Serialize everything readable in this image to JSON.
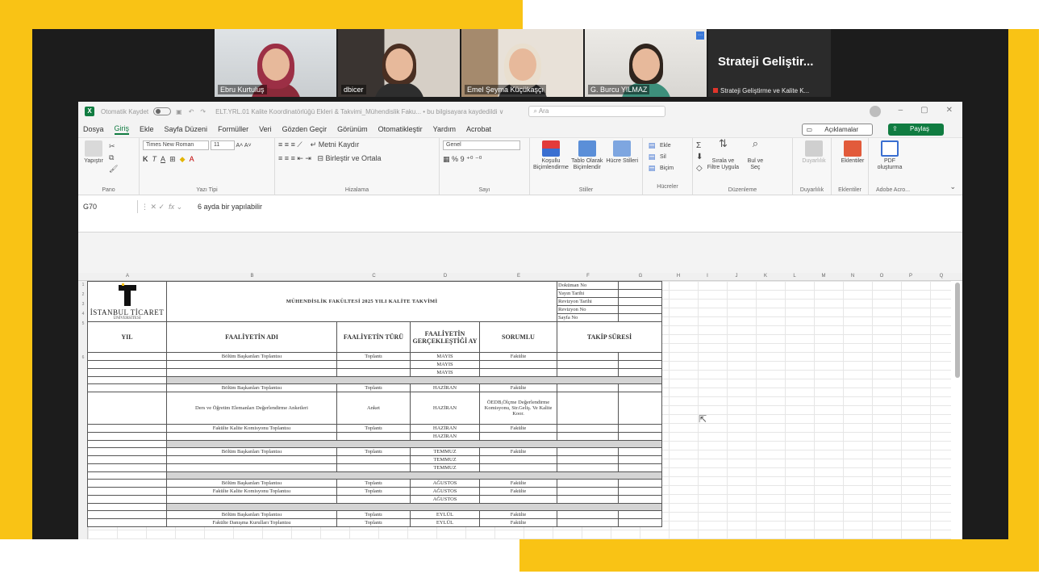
{
  "participants": [
    {
      "name": "Ebru Kurtuluş",
      "active": true
    },
    {
      "name": "dbicer",
      "active": false
    },
    {
      "name": "Emel Şeyma Küçükaşçı",
      "active": false
    },
    {
      "name": "G. Burcu YILMAZ",
      "active": false
    }
  ],
  "share": {
    "title": "Strateji Geliştir...",
    "subtitle": "Strateji Geliştirme ve Kalite K..."
  },
  "excel": {
    "autosave": "Otomatik Kaydet",
    "filename": "ELT.YRL.01 Kalite Koordinatörlüğü Ekleri & Takvimi_Mühendislik Faku... • bu bilgisayara kaydedildi ∨",
    "search": "Ara",
    "menu": [
      "Dosya",
      "Giriş",
      "Ekle",
      "Sayfa Düzeni",
      "Formüller",
      "Veri",
      "Gözden Geçir",
      "Görünüm",
      "Otomatikleştir",
      "Yardım",
      "Acrobat"
    ],
    "comments": "Açıklamalar",
    "share": "Paylaş",
    "ribbon": {
      "paste": "Yapıştır",
      "clipboard": "Pano",
      "font": "Times New Roman",
      "fontsize": "11",
      "font_group": "Yazı Tipi",
      "wrap": "Metni Kaydır",
      "merge": "Birleştir ve Ortala",
      "align_group": "Hizalama",
      "numfmt": "Genel",
      "number_group": "Sayı",
      "cond": "Koşullu Biçimlendirme",
      "astable": "Tablo Olarak Biçimlendir",
      "cellstyles": "Hücre Stilleri",
      "styles_group": "Stiller",
      "insert": "Ekle",
      "delete": "Sil",
      "format": "Biçim",
      "cells_group": "Hücreler",
      "sortfilter": "Sırala ve Filtre Uygula",
      "findselect": "Bul ve Seç",
      "edit_group": "Düzenleme",
      "sensitivity": "Duyarlılık",
      "sens_group": "Duyarlılık",
      "addins": "Eklentiler",
      "addins_group": "Eklentiler",
      "pdf": "PDF oluşturma",
      "acrobat_group": "Adobe Acro..."
    },
    "namebox": "G70",
    "formula": "6 ayda bir yapılabilir",
    "columns": [
      "A",
      "B",
      "C",
      "D",
      "E",
      "F",
      "G",
      "H",
      "I",
      "J",
      "K",
      "L",
      "M",
      "N",
      "O",
      "P",
      "Q"
    ]
  },
  "sheet": {
    "logo_line1": "İSTANBUL TİCARET",
    "logo_line2": "ÜNİVERSİTESİ",
    "title": "MÜHENDİSLİK FAKÜLTESİ 2025 YILI KALİTE TAKVİMİ",
    "docinfo": [
      "Doküman No",
      "Yayın Tarihi",
      "Revizyon Tarihi",
      "Revizyon No",
      "Sayfa No"
    ],
    "headers": [
      "YIL",
      "FAALİYETİN ADI",
      "FAALİYETİN TÜRÜ",
      "FAALİYETİN GERÇEKLEŞTİĞİ AY",
      "SORUMLU",
      "TAKİP SÜRESİ"
    ],
    "rows": [
      {
        "n": "7",
        "name": "Bölüm Başkanları Toplantısı",
        "type": "Toplantı",
        "month": "MAYIS",
        "resp": "Fakülte"
      },
      {
        "n": "8",
        "name": "",
        "type": "",
        "month": "MAYIS",
        "resp": ""
      },
      {
        "n": "9",
        "name": "",
        "type": "",
        "month": "MAYIS",
        "resp": ""
      },
      {
        "n": "10",
        "gray": true
      },
      {
        "n": "11",
        "name": "Bölüm Başkanları Toplantısı",
        "type": "Toplantı",
        "month": "HAZİRAN",
        "resp": "Fakülte"
      },
      {
        "n": "12",
        "tall": true,
        "name": "Ders ve Öğretim Elemanları Değerlendirme Anketleri",
        "type": "Anket",
        "month": "HAZİRAN",
        "resp": "ÖEDB,Ölçme Değerlendirme Komisyonu, Str.Geliş. Ve Kalite Koor."
      },
      {
        "n": "13",
        "name": "Fakülte Kalite Komisyonu Toplantısı",
        "type": "Toplantı",
        "month": "HAZİRAN",
        "resp": "Fakülte"
      },
      {
        "n": "14",
        "name": "",
        "type": "",
        "month": "HAZİRAN",
        "resp": ""
      },
      {
        "n": "15",
        "gray": true
      },
      {
        "n": "16",
        "name": "Bölüm Başkanları Toplantısı",
        "type": "Toplantı",
        "month": "TEMMUZ",
        "resp": "Fakülte"
      },
      {
        "n": "17",
        "name": "",
        "type": "",
        "month": "TEMMUZ",
        "resp": ""
      },
      {
        "n": "18",
        "name": "",
        "type": "",
        "month": "TEMMUZ",
        "resp": ""
      },
      {
        "n": "19",
        "gray": true
      },
      {
        "n": "20",
        "name": "Bölüm Başkanları Toplantısı",
        "type": "Toplantı",
        "month": "AĞUSTOS",
        "resp": "Fakülte"
      },
      {
        "n": "21",
        "name": "Fakülte Kalite Komisyonu Toplantısı",
        "type": "Toplantı",
        "month": "AĞUSTOS",
        "resp": "Fakülte"
      },
      {
        "n": "22",
        "name": "",
        "type": "",
        "month": "AĞUSTOS",
        "resp": ""
      },
      {
        "n": "23",
        "gray": true
      },
      {
        "n": "24",
        "name": "Bölüm Başkanları Toplantısı",
        "type": "Toplantı",
        "month": "EYLÜL",
        "resp": "Fakülte"
      },
      {
        "n": "25",
        "name": "Fakülte Danışma Kurulları Toplantısı",
        "type": "Toplantı",
        "month": "EYLÜL",
        "resp": "Fakülte"
      }
    ]
  }
}
